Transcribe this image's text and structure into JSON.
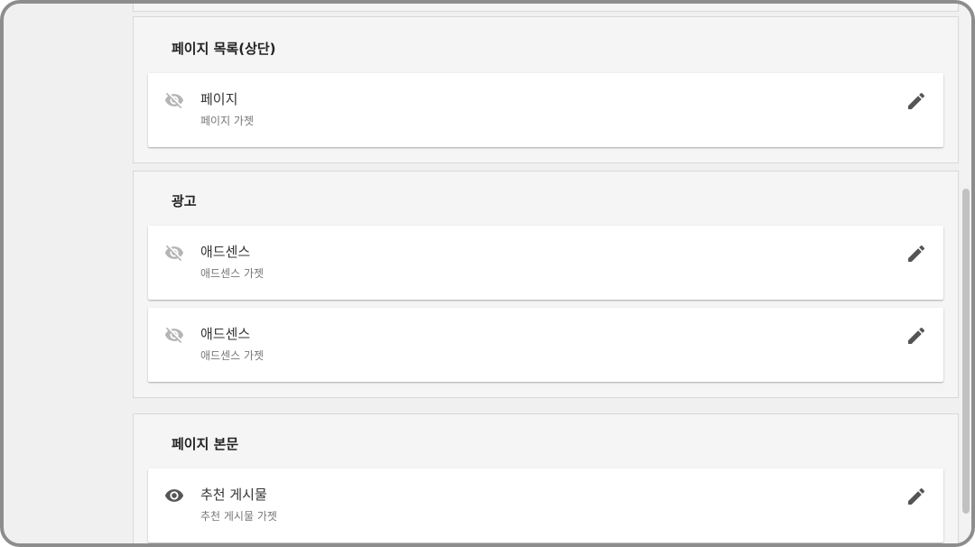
{
  "sections": [
    {
      "title": "페이지 목록(상단)",
      "gadgets": [
        {
          "title": "페이지",
          "subtitle": "페이지 가젯",
          "visible": false
        }
      ]
    },
    {
      "title": "광고",
      "gadgets": [
        {
          "title": "애드센스",
          "subtitle": "애드센스 가젯",
          "visible": false
        },
        {
          "title": "애드센스",
          "subtitle": "애드센스 가젯",
          "visible": false
        }
      ]
    },
    {
      "title": "페이지 본문",
      "gadgets": [
        {
          "title": "추천 게시물",
          "subtitle": "추천 게시물 가젯",
          "visible": true
        }
      ]
    }
  ],
  "icons": {
    "hidden": "visibility-off-icon",
    "visible": "visibility-icon",
    "edit": "pencil-icon"
  },
  "colors": {
    "icon_hidden": "#b5b5b5",
    "icon_visible": "#555555",
    "edit_icon": "#555555"
  }
}
